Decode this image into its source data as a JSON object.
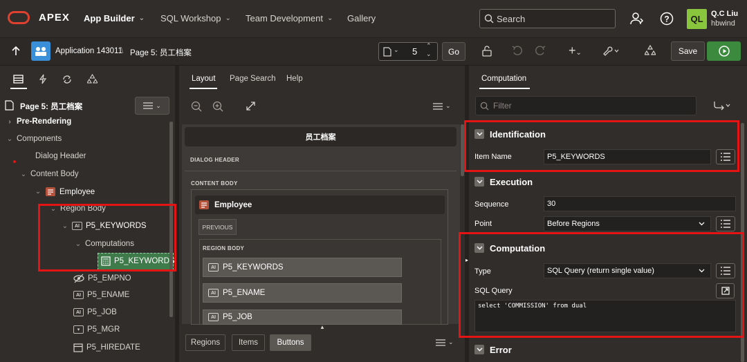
{
  "header": {
    "app_name": "APEX",
    "nav": [
      {
        "label": "App Builder"
      },
      {
        "label": "SQL Workshop"
      },
      {
        "label": "Team Development"
      },
      {
        "label": "Gallery"
      }
    ],
    "search_placeholder": "Search",
    "user": {
      "initials": "QL",
      "name": "Q.C Liu",
      "workspace": "hbwind"
    }
  },
  "toolbar": {
    "application": "Application 143011",
    "separator": "\\",
    "page": "Page 5: 员工档案",
    "page_number": "5",
    "go": "Go",
    "save": "Save"
  },
  "left": {
    "title": "Page 5: 员工档案",
    "tree": [
      {
        "label": "Pre-Rendering",
        "bold": true
      },
      {
        "label": "Components",
        "bold": false
      },
      {
        "label": "Dialog Header"
      },
      {
        "label": "Content Body"
      },
      {
        "label": "Employee",
        "bold": true
      },
      {
        "label": "Region Body"
      },
      {
        "label": "P5_KEYWORDS"
      },
      {
        "label": "Computations"
      },
      {
        "label": "P5_KEYWORDS"
      },
      {
        "label": "P5_EMPNO"
      },
      {
        "label": "P5_ENAME"
      },
      {
        "label": "P5_JOB"
      },
      {
        "label": "P5_MGR"
      },
      {
        "label": "P5_HIREDATE"
      }
    ]
  },
  "middle": {
    "tabs": [
      "Layout",
      "Page Search",
      "Help"
    ],
    "page_title": "员工档案",
    "dialog_header": "DIALOG HEADER",
    "content_body": "CONTENT BODY",
    "region": "Employee",
    "previous": "PREVIOUS",
    "region_body": "REGION BODY",
    "fields": [
      "P5_KEYWORDS",
      "P5_ENAME",
      "P5_JOB"
    ],
    "bottom_tabs": [
      "Regions",
      "Items",
      "Buttons"
    ]
  },
  "right": {
    "tab": "Computation",
    "filter_placeholder": "Filter",
    "identification": {
      "title": "Identification",
      "item_name_label": "Item Name",
      "item_name": "P5_KEYWORDS"
    },
    "execution": {
      "title": "Execution",
      "sequence_label": "Sequence",
      "sequence": "30",
      "point_label": "Point",
      "point": "Before Regions"
    },
    "computation": {
      "title": "Computation",
      "type_label": "Type",
      "type": "SQL Query (return single value)",
      "sql_label": "SQL Query",
      "sql": "select 'COMMISSION' from dual"
    },
    "error": {
      "title": "Error"
    }
  },
  "colors": {
    "highlight": "#e41414",
    "accent_green": "#3b8a3e",
    "avatar": "#8ac53e"
  }
}
